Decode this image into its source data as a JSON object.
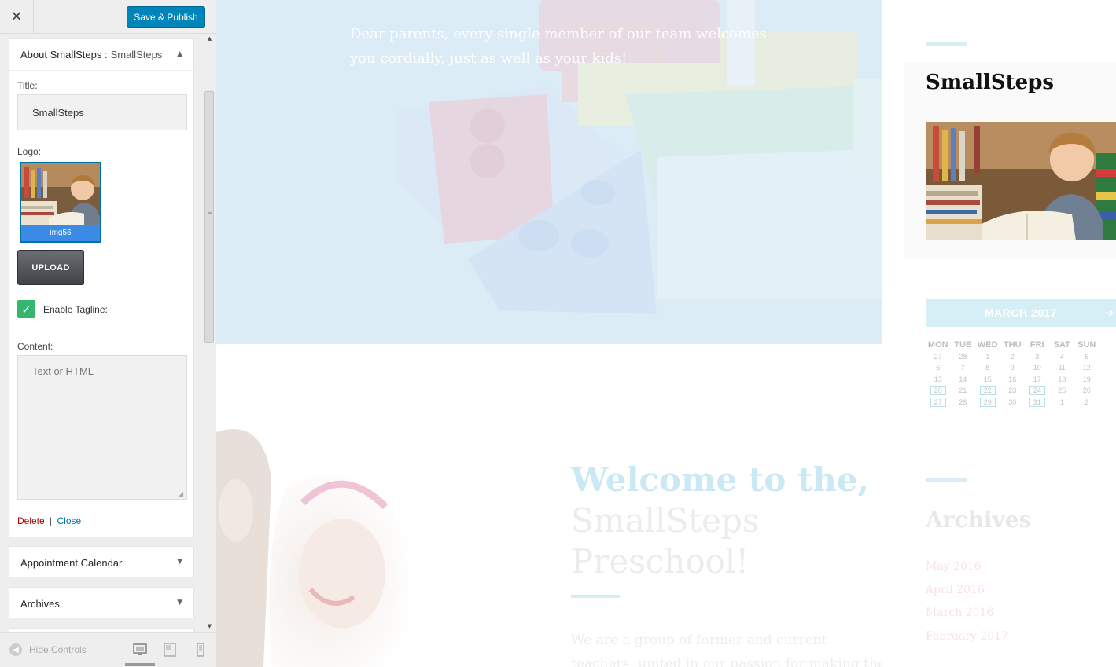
{
  "toolbar": {
    "close_glyph": "✕",
    "publish_label": "Save & Publish"
  },
  "widget_about": {
    "title": "About SmallSteps :",
    "subtitle": "SmallSteps",
    "collapse_glyph": "▲",
    "title_label": "Title:",
    "title_value": "SmallSteps",
    "logo_label": "Logo:",
    "logo_caption": "img56",
    "upload_label": "UPLOAD",
    "tagline_checked": true,
    "check_glyph": "✓",
    "tagline_label": "Enable Tagline:",
    "content_label": "Content:",
    "content_placeholder": "Text or HTML",
    "delete_label": "Delete",
    "separator": "|",
    "close_label": "Close"
  },
  "widget_list": [
    {
      "label": "Appointment Calendar",
      "expand_glyph": "▼"
    },
    {
      "label": "Archives",
      "expand_glyph": "▼"
    }
  ],
  "scrollbar": {
    "up_glyph": "▲",
    "down_glyph": "▼"
  },
  "footer": {
    "hide_controls_label": "Hide Controls",
    "hide_icon_glyph": "◀",
    "devices": [
      "desktop-icon",
      "tablet-icon",
      "mobile-icon"
    ],
    "active_device": "desktop"
  },
  "preview": {
    "hero_text": "Dear parents, every single member of our team welcomes you cordially, just as well as your kids!",
    "welcome_line1": "Welcome to the,",
    "welcome_line2": "SmallSteps",
    "welcome_line3": "Preschool!",
    "intro_text": "We are a group of former and current teachers, united in our passion for making the preschool"
  },
  "side": {
    "about_title": "SmallSteps",
    "calendar_title": "MARCH 2017",
    "calendar_next_glyph": "➔",
    "weekdays": [
      "MON",
      "TUE",
      "WED",
      "THU",
      "FRI",
      "SAT",
      "SUN"
    ],
    "weeks": [
      [
        "27",
        "28",
        "1",
        "2",
        "3",
        "4",
        "5"
      ],
      [
        "6",
        "7",
        "8",
        "9",
        "10",
        "11",
        "12"
      ],
      [
        "13",
        "14",
        "15",
        "16",
        "17",
        "18",
        "19"
      ],
      [
        "20",
        "21",
        "22",
        "23",
        "24",
        "25",
        "26"
      ],
      [
        "27",
        "28",
        "29",
        "30",
        "31",
        "1",
        "2"
      ]
    ],
    "marked_days": [
      "3-0",
      "3-2",
      "3-4",
      "4-0",
      "4-2",
      "4-4"
    ],
    "archives_title": "Archives",
    "archive_links": [
      "May 2016",
      "April 2016",
      "March 2016",
      "February 2017"
    ]
  },
  "colors": {
    "publish": "#0085ba",
    "check": "#33b76c",
    "delete": "#aa0000",
    "link": "#0073aa",
    "calendar_header": "#d6eef6"
  }
}
